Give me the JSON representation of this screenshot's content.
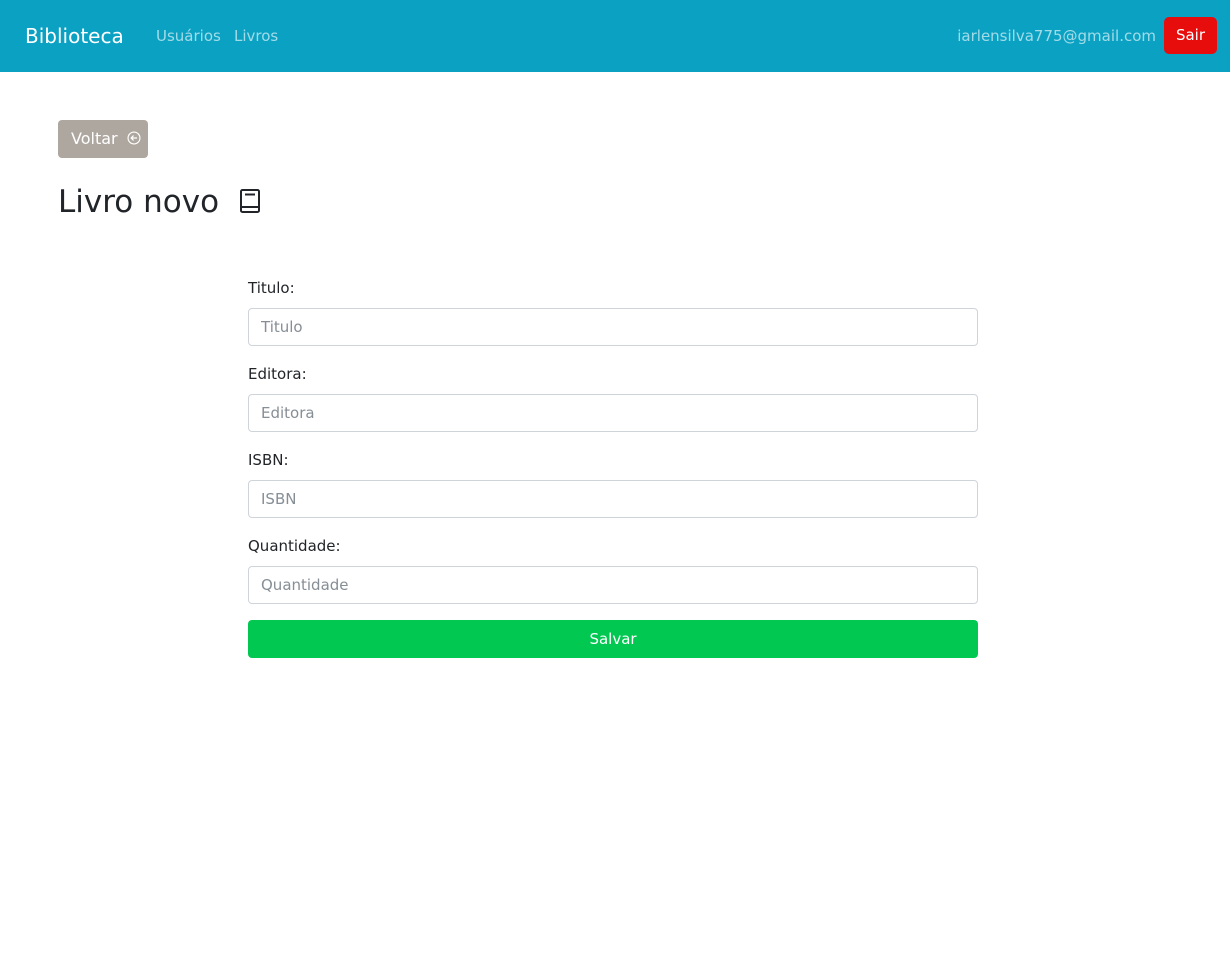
{
  "navbar": {
    "brand": "Biblioteca",
    "links": [
      {
        "label": "Usuários"
      },
      {
        "label": "Livros"
      }
    ],
    "user_email": "iarlensilva775@gmail.com",
    "logout_label": "Sair",
    "background": "#0aa1c3",
    "logout_color": "#e80d0d"
  },
  "back_button": {
    "label": "Voltar",
    "icon": "arrow-left-circle-icon",
    "color": "#aea79f"
  },
  "page": {
    "title": "Livro novo",
    "title_icon": "book-icon"
  },
  "form": {
    "fields": [
      {
        "label": "Titulo:",
        "placeholder": "Titulo",
        "value": ""
      },
      {
        "label": "Editora:",
        "placeholder": "Editora",
        "value": ""
      },
      {
        "label": "ISBN:",
        "placeholder": "ISBN",
        "value": ""
      },
      {
        "label": "Quantidade:",
        "placeholder": "Quantidade",
        "value": ""
      }
    ],
    "submit_label": "Salvar",
    "submit_color": "#00c851"
  }
}
